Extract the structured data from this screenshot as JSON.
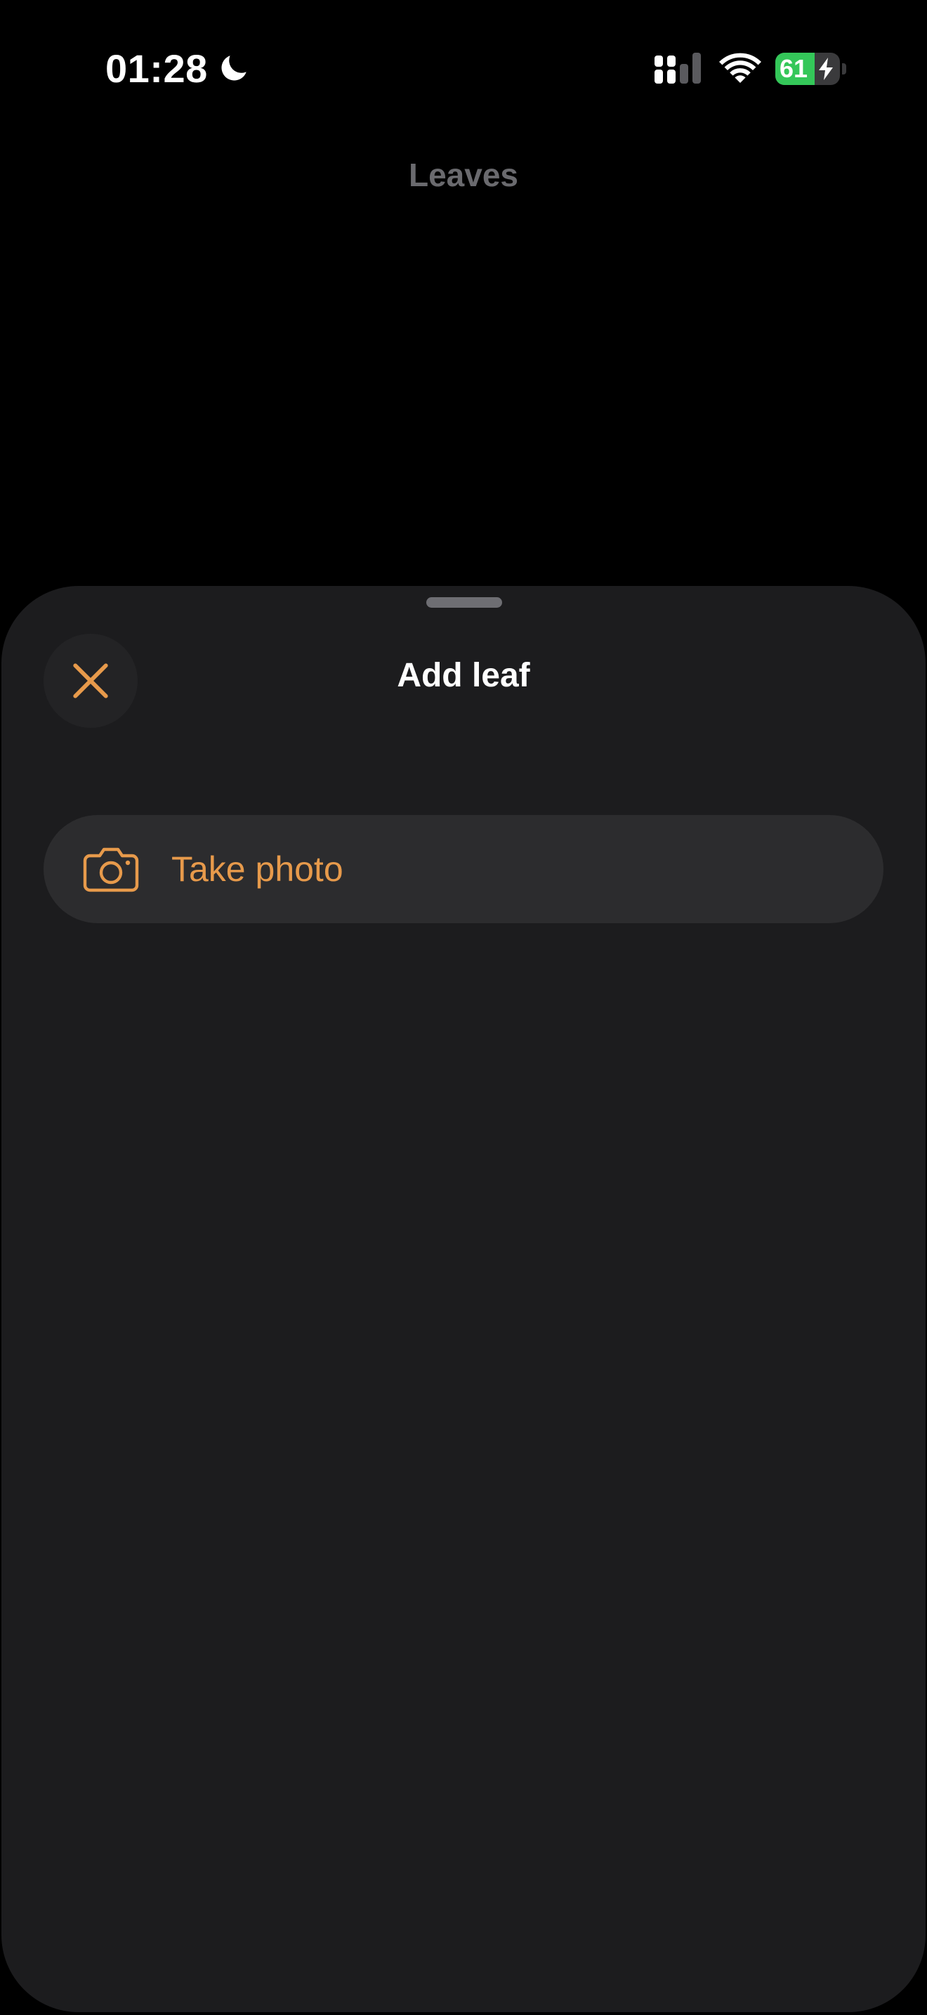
{
  "status_bar": {
    "time": "01:28",
    "focus_icon": "moon-icon",
    "signal_icon": "cellular-signal-icon",
    "wifi_icon": "wifi-icon",
    "battery_level": "61",
    "battery_fraction": 0.61,
    "battery_charging": true
  },
  "background_screen": {
    "title": "Leaves"
  },
  "sheet": {
    "title": "Add leaf",
    "close_icon": "close-icon",
    "actions": [
      {
        "label": "Take photo",
        "icon": "camera-icon"
      }
    ]
  },
  "colors": {
    "accent": "#e79a4b",
    "sheet_background": "#1c1c1e",
    "button_background": "#2c2c2e",
    "battery_fill": "#34c759"
  }
}
